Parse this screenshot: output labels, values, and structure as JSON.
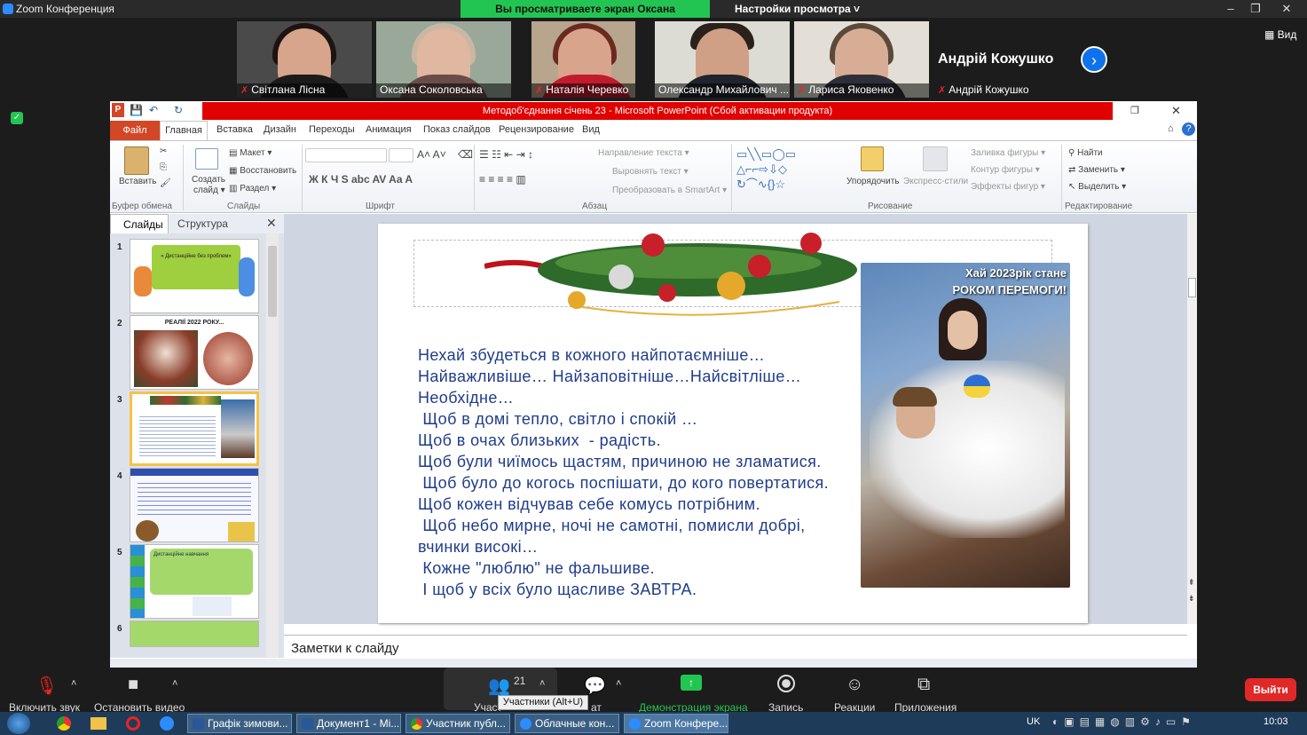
{
  "zoom": {
    "window_title": "Zoom Конференция",
    "share_banner": "Вы просматриваете экран Оксана Соколовська",
    "view_options": "Настройки просмотра ˅",
    "view_button": "Вид",
    "active_speaker": "Андрій Кожушко",
    "participants": [
      {
        "name": "Світлана Лісна",
        "muted": true,
        "bg": "#7b6a55"
      },
      {
        "name": "Оксана Соколовська",
        "muted": false,
        "bg": "#a7b2a5"
      },
      {
        "name": "Наталія Черевко",
        "muted": true,
        "bg": "#b9a994"
      },
      {
        "name": "Олександр Михайлович ...",
        "muted": false,
        "bg": "#d9d8d2"
      },
      {
        "name": "Лариса Яковенко",
        "muted": true,
        "bg": "#e4e0d8"
      },
      {
        "name": "Андрій Кожушко",
        "muted": true,
        "bg": "#1c1c1c"
      }
    ],
    "controls": {
      "audio": "Включить звук",
      "video": "Остановить видео",
      "participants": "Участ",
      "participants_count": "21",
      "chat": "ат",
      "share": "Демонстрация экрана",
      "record": "Запись",
      "reactions": "Реакции",
      "apps": "Приложения",
      "leave": "Выйти",
      "tooltip": "Участники (Alt+U)"
    },
    "colors": {
      "share_green": "#23c552",
      "leave_red": "#e02828",
      "accent_blue": "#0e72ed"
    }
  },
  "ppt": {
    "title": "Методоб'єднання січень 23 - Microsoft PowerPoint (Сбой активации продукта)",
    "tabs": {
      "file": "Файл",
      "home": "Главная",
      "insert": "Вставка",
      "design": "Дизайн",
      "transitions": "Переходы",
      "animation": "Анимация",
      "slideshow": "Показ слайдов",
      "review": "Рецензирование",
      "view": "Вид"
    },
    "ribbon": {
      "paste": "Вставить",
      "clipboard": "Буфер обмена",
      "layout": "Макет ▾",
      "reset": "Восстановить",
      "section": "Раздел ▾",
      "new_slide": "Создать",
      "new_slide2": "слайд ▾",
      "slides_group": "Слайды",
      "font_group": "Шрифт",
      "paragraph_group": "Абзац",
      "text_direction": "Направление текста ▾",
      "align_text": "Выровнять текст ▾",
      "smartart": "Преобразовать в SmartArt ▾",
      "arrange": "Упорядочить",
      "quick_styles": "Экспресс-стили",
      "shape_fill": "Заливка фигуры ▾",
      "shape_outline": "Контур фигуры ▾",
      "shape_effects": "Эффекты фигур ▾",
      "drawing_group": "Рисование",
      "find": "Найти",
      "replace": "Заменить ▾",
      "select": "Выделить ▾",
      "editing_group": "Редактирование"
    },
    "pane": {
      "slides_tab": "Слайды",
      "outline_tab": "Структура"
    },
    "thumbnails": [
      {
        "num": "1",
        "caption": "« Дистанційне без проблем»"
      },
      {
        "num": "2",
        "caption": "РЕАЛІЇ 2022 РОКУ..."
      },
      {
        "num": "3",
        "caption": ""
      },
      {
        "num": "4",
        "caption": ""
      },
      {
        "num": "5",
        "caption": "Дистанційне навчання"
      },
      {
        "num": "6",
        "caption": ""
      }
    ],
    "slide": {
      "text": "Нехай збудеться в кожного найпотаємніше…\nНайважливіше… Найзаповітніше…Найсвітліше…\nНеобхідне…\n Щоб в домі тепло, світло і спокій …\nЩоб в очах близьких  - радість.\nЩоб були чиїмось щастям, причиною не зламатися.\n Щоб було до когось поспішати, до кого повертатися.\nЩоб кожен відчував себе комусь потрібним.\n Щоб небо мирне, ночі не самотні, помисли добрі,\nвчинки високі…\n Кожне \"люблю\" не фальшиве.\n І щоб у всіх було щасливе ЗАВТРА.",
      "photo_caption_1": "Хай 2023рік стане",
      "photo_caption_2": "РОКОМ ПЕРЕМОГИ!"
    },
    "notes_placeholder": "Заметки к слайду"
  },
  "taskbar": {
    "items": [
      "Графік зимови...",
      "Документ1 - Mi...",
      "Участник публ...",
      "Облачные кон...",
      "Zoom Конфере..."
    ],
    "lang": "UK",
    "time": "10:03"
  }
}
